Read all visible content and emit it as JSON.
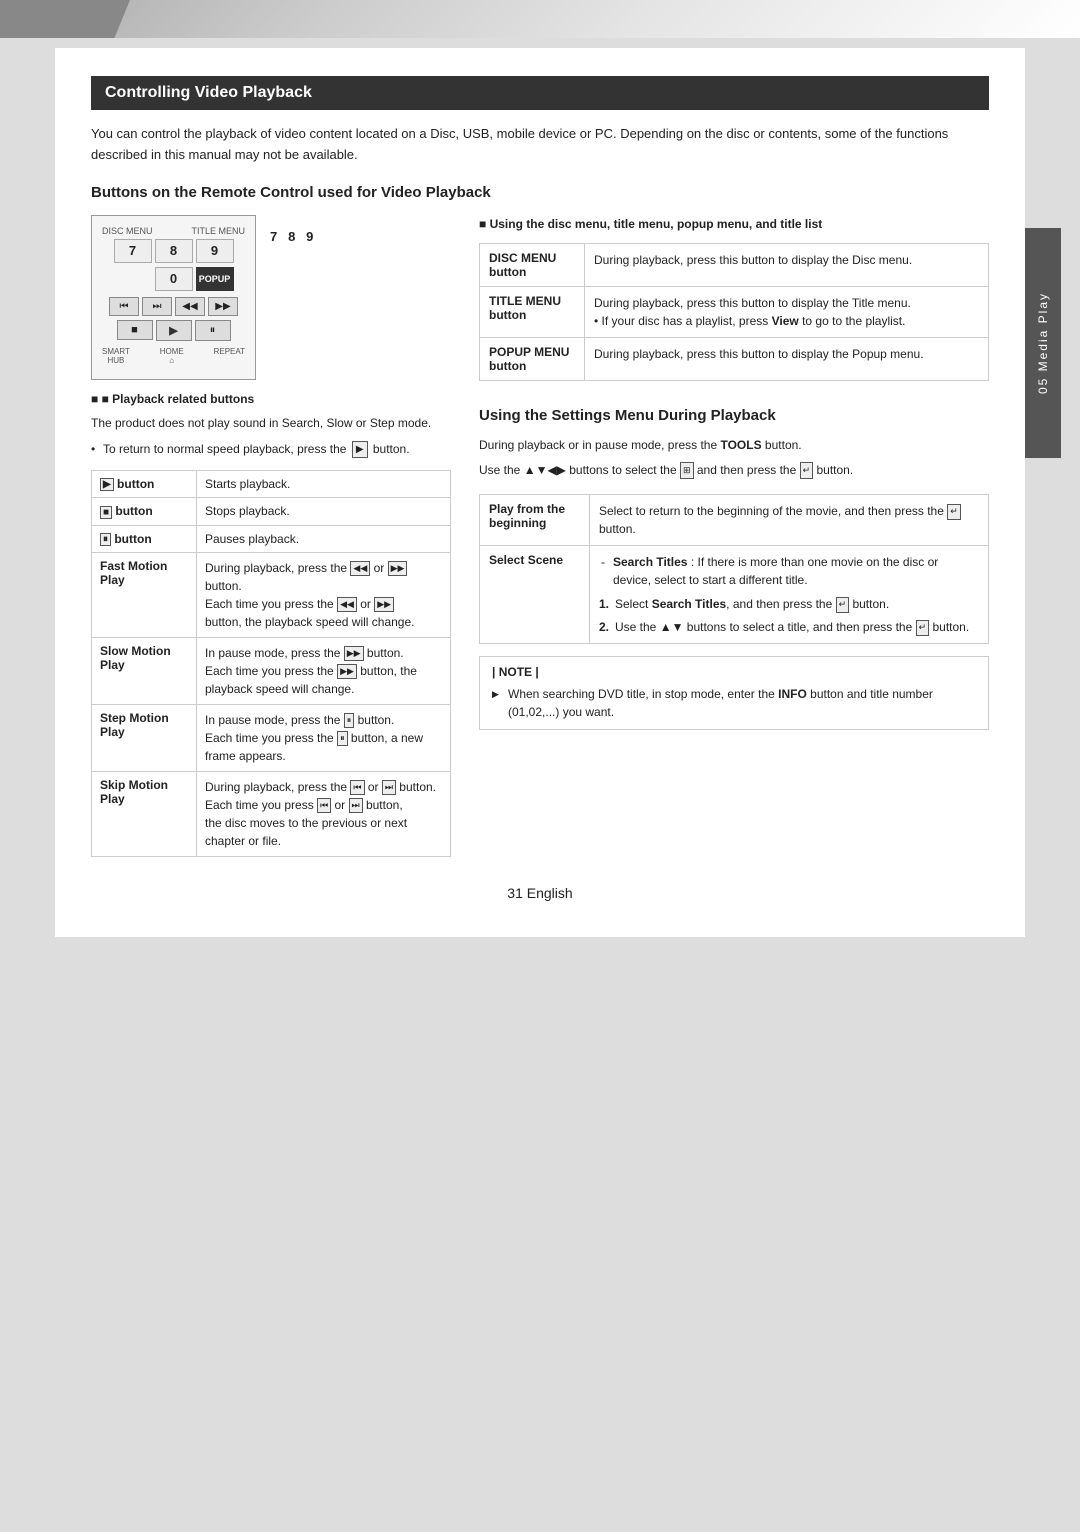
{
  "page": {
    "number": "31",
    "language": "English"
  },
  "side_tab": {
    "label": "05  Media Play"
  },
  "section": {
    "title": "Controlling Video Playback",
    "intro": "You can control the playback of video content located on a Disc, USB, mobile device or PC. Depending on the disc or contents, some of the functions described in this manual may not be available."
  },
  "subsection_buttons": {
    "title": "Buttons on the Remote Control used for Video Playback",
    "playback_label": "■  Playback related buttons",
    "playback_note": "The product does not play sound in Search, Slow or Step mode.",
    "playback_bullet": "To return to normal speed playback, press the",
    "playback_bullet_icon": "▶",
    "playback_bullet_end": "button.",
    "remote": {
      "numbers": [
        "7",
        "8",
        "9"
      ],
      "zero": "0",
      "labels_top": [
        "DISC MENU",
        "TITLE MENU",
        "POPUP"
      ],
      "ctrl_row1": [
        "⏮",
        "⏭",
        "◀◀",
        "▶▶"
      ],
      "ctrl_row2": [
        "■",
        "▶",
        "⏸"
      ],
      "labels_bottom": [
        "SMART HUB",
        "HOME",
        "REPEAT"
      ]
    }
  },
  "playback_table": {
    "rows": [
      {
        "label": "▶ button",
        "desc": "Starts playback."
      },
      {
        "label": "■ button",
        "desc": "Stops playback."
      },
      {
        "label": "⏸ button",
        "desc": "Pauses playback."
      },
      {
        "label": "Fast Motion Play",
        "desc": "During playback, press the ◀◀ or ▶▶ button.\nEach time you press the ◀◀ or ▶▶ button, the playback speed will change."
      },
      {
        "label": "Slow Motion Play",
        "desc": "In pause mode, press the ▶▶ button.\nEach time you press the ▶▶ button, the playback speed will change."
      },
      {
        "label": "Step Motion Play",
        "desc": "In pause mode, press the ⏸ button.\nEach time you press the ⏸ button, a new frame appears."
      },
      {
        "label": "Skip Motion Play",
        "desc": "During playback, press the ⏮ or ⏭ button.\nEach time you press ⏮ or ⏭ button, the disc moves to the previous or next chapter or file."
      }
    ]
  },
  "disc_menu_section": {
    "title": "■  Using the disc menu, title menu, popup menu, and title list",
    "rows": [
      {
        "label": "DISC MENU button",
        "desc": "During playback, press this button to display the Disc menu."
      },
      {
        "label": "TITLE MENU button",
        "desc": "During playback, press this button to display the Title menu.\n• If your disc has a playlist, press View to go to the playlist."
      },
      {
        "label": "POPUP MENU button",
        "desc": "During playback, press this button to display the Popup menu."
      }
    ]
  },
  "settings_section": {
    "title": "Using the Settings Menu During Playback",
    "intro_line1": "During playback or in pause mode, press the",
    "tools_label": "TOOLS",
    "intro_line1_end": "button.",
    "intro_line2": "Use the ▲▼◀▶ buttons to select the",
    "intro_icon": "⬛",
    "intro_line2_end": "and then press the",
    "enter_icon": "↵",
    "intro_line2_last": "button.",
    "rows": [
      {
        "label": "Play from the beginning",
        "desc": "Select to return to the beginning of the movie, and then press the  ↵  button."
      },
      {
        "label": "Select Scene",
        "desc_parts": [
          {
            "type": "sub",
            "text": "Search Titles : If there is more than one movie on the disc or device, select to start a different title."
          },
          {
            "type": "num",
            "num": "1.",
            "text": "Select Search Titles, and then press the  ↵  button."
          },
          {
            "type": "num",
            "num": "2.",
            "text": "Use the ▲▼ buttons to select a title, and then press the  ↵  button."
          }
        ]
      }
    ],
    "note": {
      "label": "| NOTE |",
      "items": [
        "When searching DVD title, in stop mode, enter the INFO button and title number (01,02,...) you want."
      ]
    }
  }
}
